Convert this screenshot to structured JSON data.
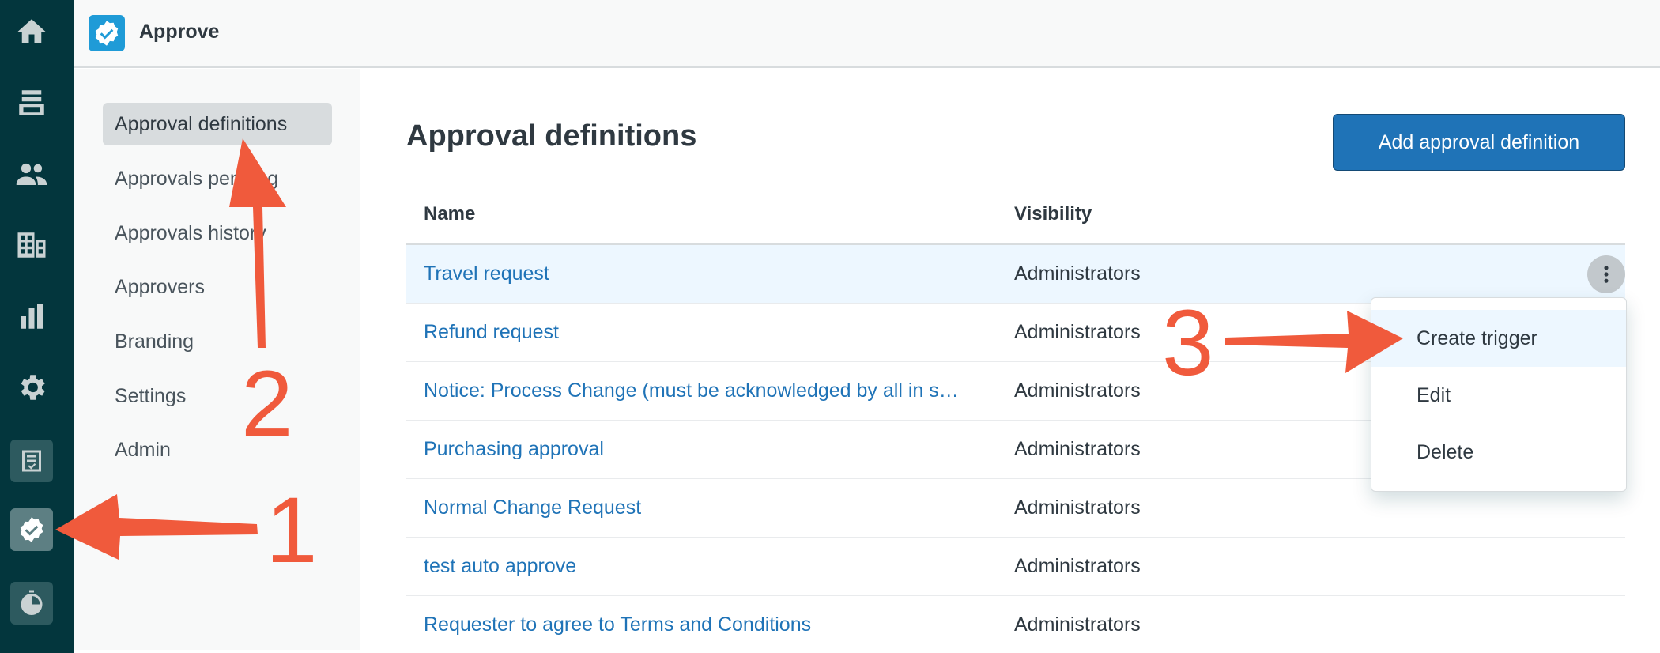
{
  "app": {
    "title": "Approve"
  },
  "leftnav": {
    "items": [
      {
        "icon": "home-icon"
      },
      {
        "icon": "views-icon"
      },
      {
        "icon": "customers-icon"
      },
      {
        "icon": "organizations-icon"
      },
      {
        "icon": "reporting-icon"
      },
      {
        "icon": "admin-gear-icon"
      },
      {
        "icon": "checklist-app-icon"
      },
      {
        "icon": "approve-app-icon",
        "active": true
      },
      {
        "icon": "timer-app-icon"
      }
    ]
  },
  "subnav": {
    "items": [
      {
        "label": "Approval definitions",
        "selected": true
      },
      {
        "label": "Approvals pending"
      },
      {
        "label": "Approvals history"
      },
      {
        "label": "Approvers"
      },
      {
        "label": "Branding"
      },
      {
        "label": "Settings"
      },
      {
        "label": "Admin"
      }
    ]
  },
  "main": {
    "title": "Approval definitions",
    "add_button": "Add approval definition",
    "table": {
      "headers": {
        "name": "Name",
        "visibility": "Visibility"
      },
      "rows": [
        {
          "name": "Travel request",
          "visibility": "Administrators"
        },
        {
          "name": "Refund request",
          "visibility": "Administrators"
        },
        {
          "name": "Notice: Process Change (must be acknowledged by all in s…",
          "visibility": "Administrators"
        },
        {
          "name": "Purchasing approval",
          "visibility": "Administrators"
        },
        {
          "name": "Normal Change Request",
          "visibility": "Administrators"
        },
        {
          "name": "test auto approve",
          "visibility": "Administrators"
        },
        {
          "name": "Requester to agree to Terms and Conditions",
          "visibility": "Administrators"
        }
      ]
    }
  },
  "row_menu": {
    "items": [
      {
        "label": "Create trigger"
      },
      {
        "label": "Edit"
      },
      {
        "label": "Delete"
      }
    ]
  },
  "annotations": {
    "step1": "1",
    "step2": "2",
    "step3": "3",
    "color": "#f05a3c"
  },
  "colors": {
    "nav_bg": "#03363d",
    "primary": "#1f73b7",
    "link": "#1f73b7",
    "selected_bg": "#d8dcde",
    "row_hover": "#edf7ff"
  }
}
